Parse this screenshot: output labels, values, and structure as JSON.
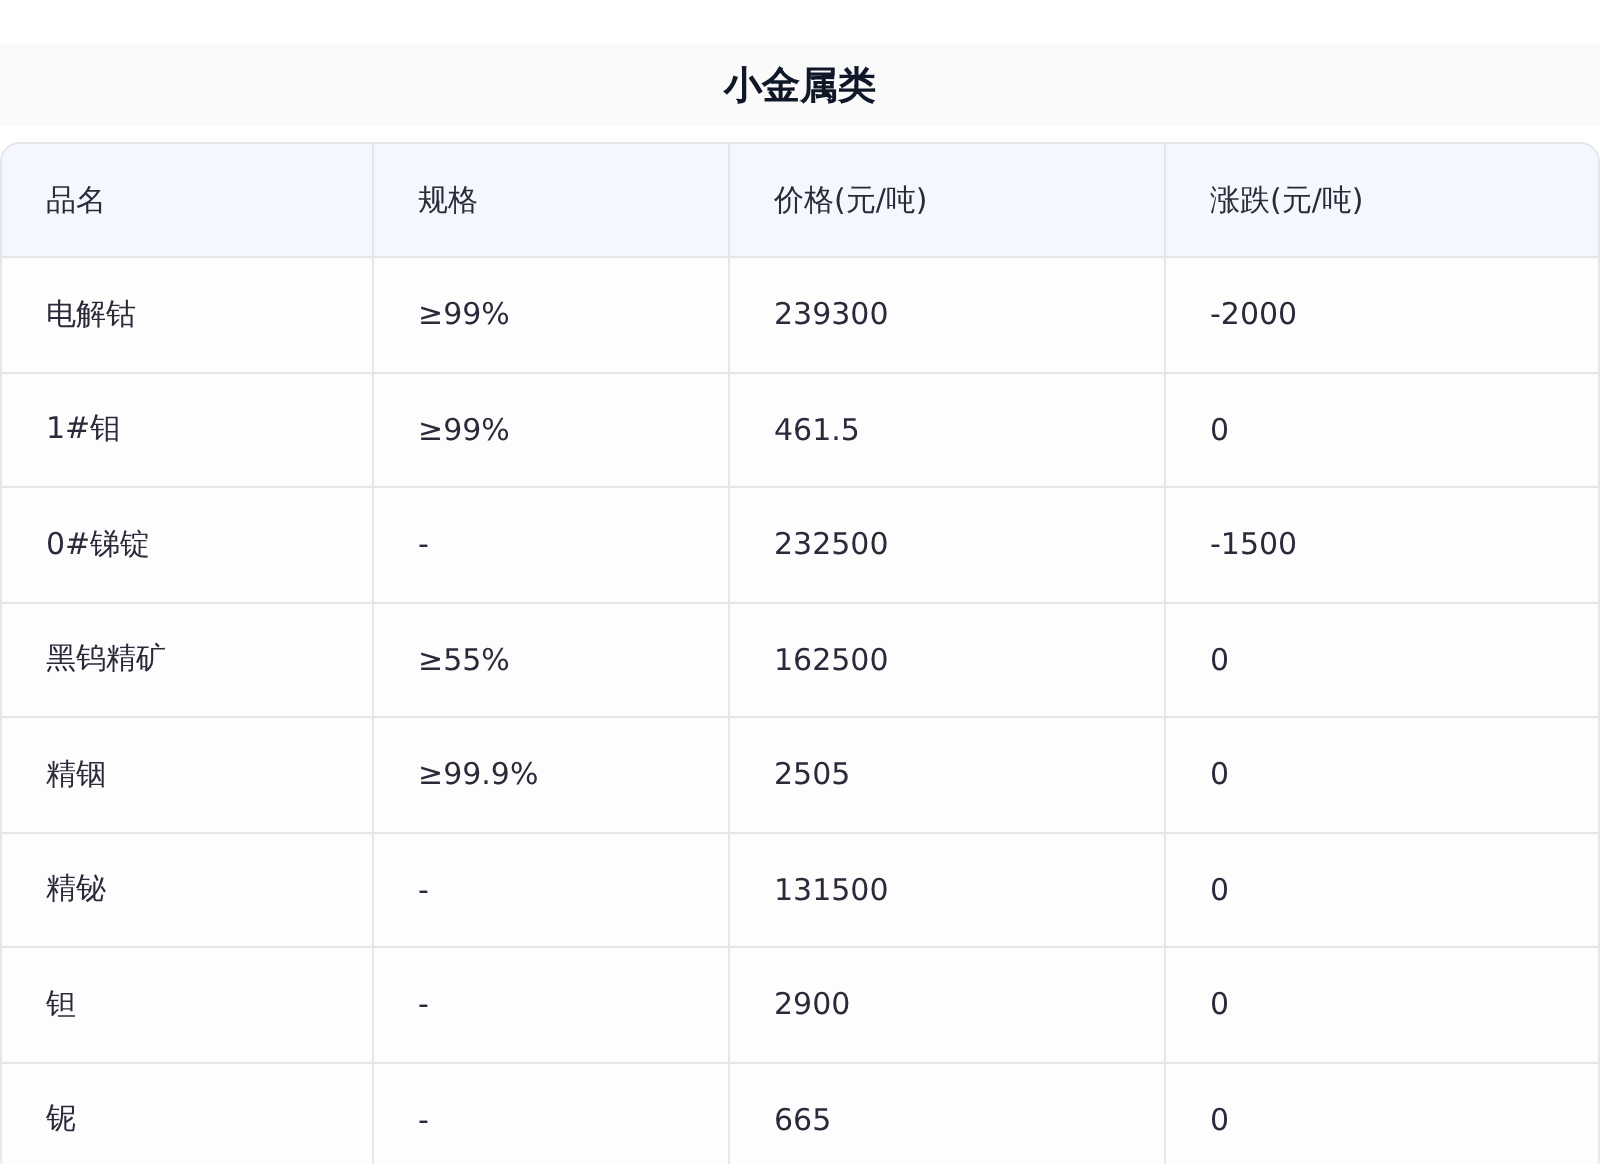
{
  "title": "小金属类",
  "table": {
    "columns": [
      "品名",
      "规格",
      "价格(元/吨)",
      "涨跌(元/吨)"
    ],
    "rows": [
      [
        "电解钴",
        "≥99%",
        "239300",
        "-2000"
      ],
      [
        "1#钼",
        "≥99%",
        "461.5",
        "0"
      ],
      [
        "0#锑锭",
        "-",
        "232500",
        "-1500"
      ],
      [
        "黑钨精矿",
        "≥55%",
        "162500",
        "0"
      ],
      [
        "精铟",
        "≥99.9%",
        "2505",
        "0"
      ],
      [
        "精铋",
        "-",
        "131500",
        "0"
      ],
      [
        "钽",
        "-",
        "2900",
        "0"
      ],
      [
        "铌",
        "-",
        "665",
        "0"
      ]
    ]
  }
}
